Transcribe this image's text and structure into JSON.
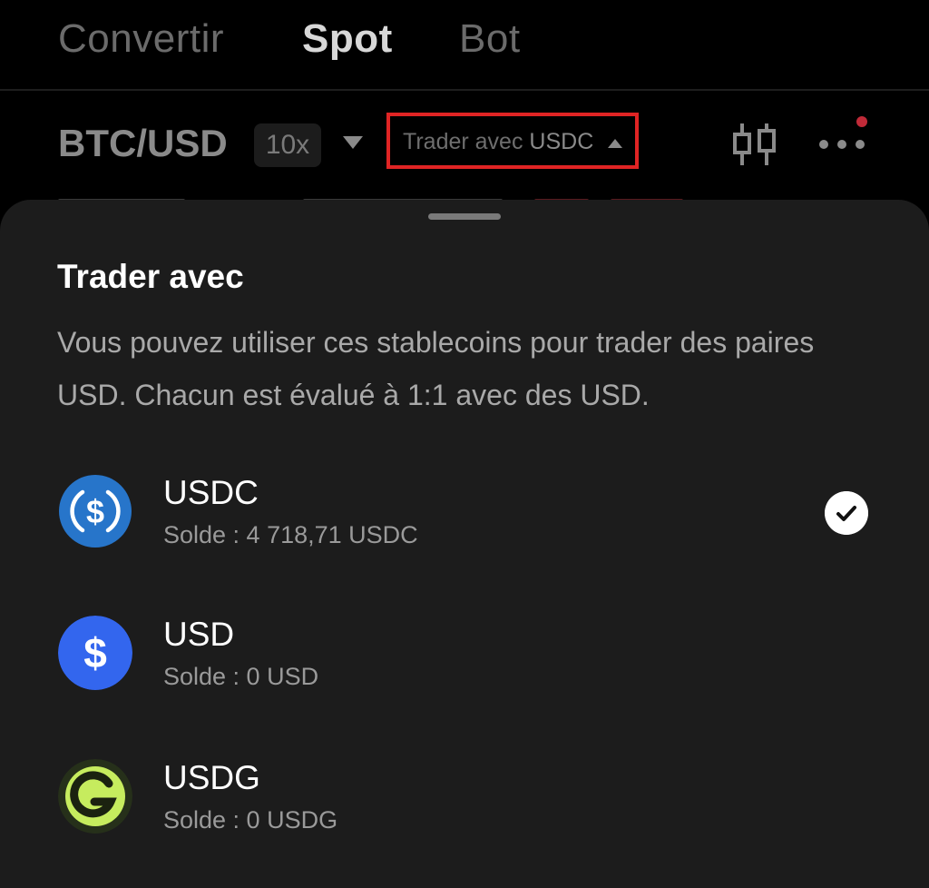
{
  "tabs": [
    {
      "label": "Convertir",
      "active": false
    },
    {
      "label": "Spot",
      "active": true
    },
    {
      "label": "Bot",
      "active": false
    }
  ],
  "header": {
    "pair": "BTC/USD",
    "leverage": "10x",
    "trade_with_prefix": "Trader avec",
    "trade_with_asset": "USDC",
    "icons": [
      "chart-candlestick-icon",
      "more-icon",
      "notification-dot"
    ]
  },
  "sheet": {
    "title": "Trader avec",
    "description": "Vous pouvez utiliser ces stablecoins pour trader des paires USD. Chacun est évalué à 1:1 avec des USD.",
    "options": [
      {
        "name": "USDC",
        "balance": "Solde : 4 718,71 USDC",
        "selected": true,
        "icon": "usdc-icon",
        "color": "#2775ca"
      },
      {
        "name": "USD",
        "balance": "Solde : 0 USD",
        "selected": false,
        "icon": "usd-icon",
        "color": "#3366ee"
      },
      {
        "name": "USDG",
        "balance": "Solde : 0 USDG",
        "selected": false,
        "icon": "usdg-icon",
        "color": "#c6ec5e"
      }
    ]
  },
  "colors": {
    "highlight_border": "#e02424",
    "sheet_bg": "#1c1c1c",
    "notification": "#c02a38"
  }
}
